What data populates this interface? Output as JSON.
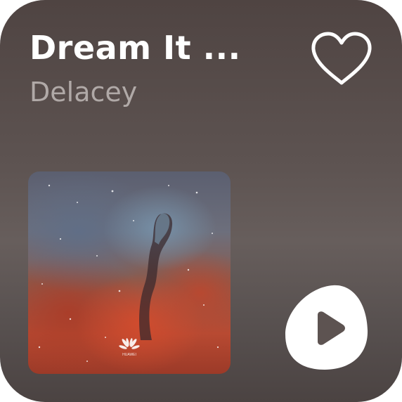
{
  "track": {
    "title": "Dream It ...",
    "artist": "Delacey"
  },
  "controls": {
    "favorite_icon": "heart-outline-icon",
    "play_icon": "play-icon"
  },
  "artwork": {
    "logo": "HUAWEI"
  },
  "colors": {
    "background": "#5d5351",
    "title": "#ffffff",
    "artist": "#b0a9a7",
    "play_button": "#ffffff",
    "play_glyph": "#5d5351"
  }
}
